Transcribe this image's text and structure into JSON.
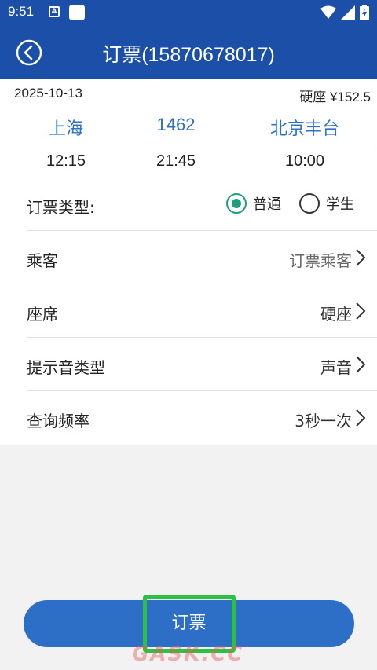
{
  "status_bar": {
    "time": "9:51",
    "notif_badge": "A"
  },
  "header": {
    "title": "订票(15870678017)"
  },
  "trip": {
    "date": "2025-10-13",
    "seat_price": "硬座 ¥152.5",
    "from": "上海",
    "train_no": "1462",
    "to": "北京丰台",
    "depart_time": "12:15",
    "duration_time": "21:45",
    "arrive_time": "10:00"
  },
  "form": {
    "ticket_type": {
      "label": "订票类型:",
      "options": [
        "普通",
        "学生"
      ],
      "selected": "普通"
    },
    "passenger": {
      "label": "乘客",
      "value": "订票乘客"
    },
    "seat": {
      "label": "座席",
      "value": "硬座"
    },
    "sound": {
      "label": "提示音类型",
      "value": "声音"
    },
    "frequency": {
      "label": "查询频率",
      "value": "3秒一次"
    }
  },
  "actions": {
    "book_label": "订票"
  },
  "watermark": "GASK.CC",
  "colors": {
    "primary": "#1b4fa8",
    "accent": "#2d73c6",
    "radio_on": "#1f9e7c",
    "highlight": "#2ec040"
  }
}
